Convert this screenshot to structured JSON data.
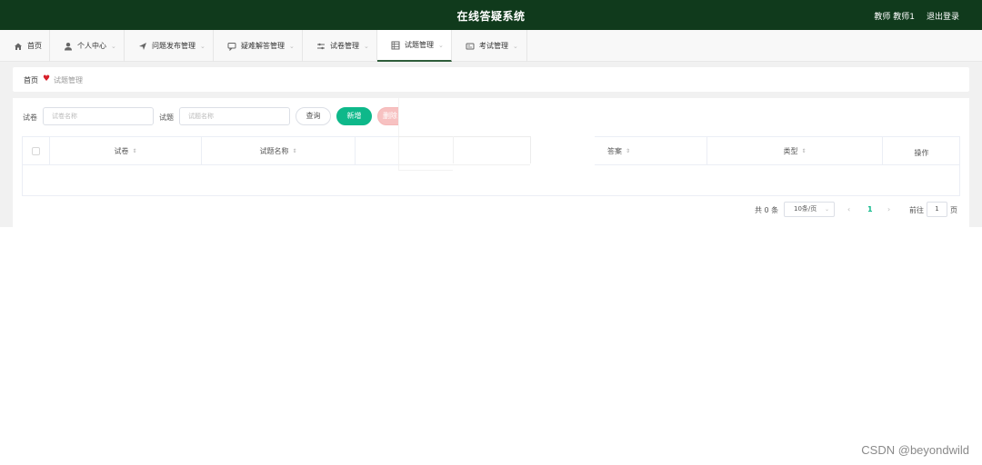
{
  "header": {
    "title": "在线答疑系统",
    "user": "教师 教师1",
    "logout": "退出登录"
  },
  "nav": [
    {
      "label": "首页",
      "icon": "home-icon"
    },
    {
      "label": "个人中心",
      "icon": "user-icon"
    },
    {
      "label": "问题发布管理",
      "icon": "send-icon"
    },
    {
      "label": "疑难解答管理",
      "icon": "chat-icon"
    },
    {
      "label": "试卷管理",
      "icon": "sliders-icon"
    },
    {
      "label": "试题管理",
      "icon": "grid-icon"
    },
    {
      "label": "考试管理",
      "icon": "card-icon"
    }
  ],
  "breadcrumb": {
    "home": "首页",
    "current": "试题管理"
  },
  "search": {
    "paper_label": "试卷",
    "paper_placeholder": "试卷名称",
    "question_label": "试题",
    "question_placeholder": "试题名称",
    "query_button": "查询",
    "add_button": "新增",
    "delete_button": "删除"
  },
  "table": {
    "columns": [
      "试卷",
      "试题名称",
      "答案",
      "类型",
      "操作"
    ]
  },
  "pagination": {
    "total": "共 0 条",
    "page_size": "10条/页",
    "current_page": "1",
    "goto_label": "前往",
    "goto_value": "1",
    "page_unit": "页"
  },
  "watermark": "CSDN @beyondwild",
  "colors": {
    "header_bg": "#103a1c",
    "accent": "#0eb88a",
    "danger_light": "#f7c1c1"
  }
}
